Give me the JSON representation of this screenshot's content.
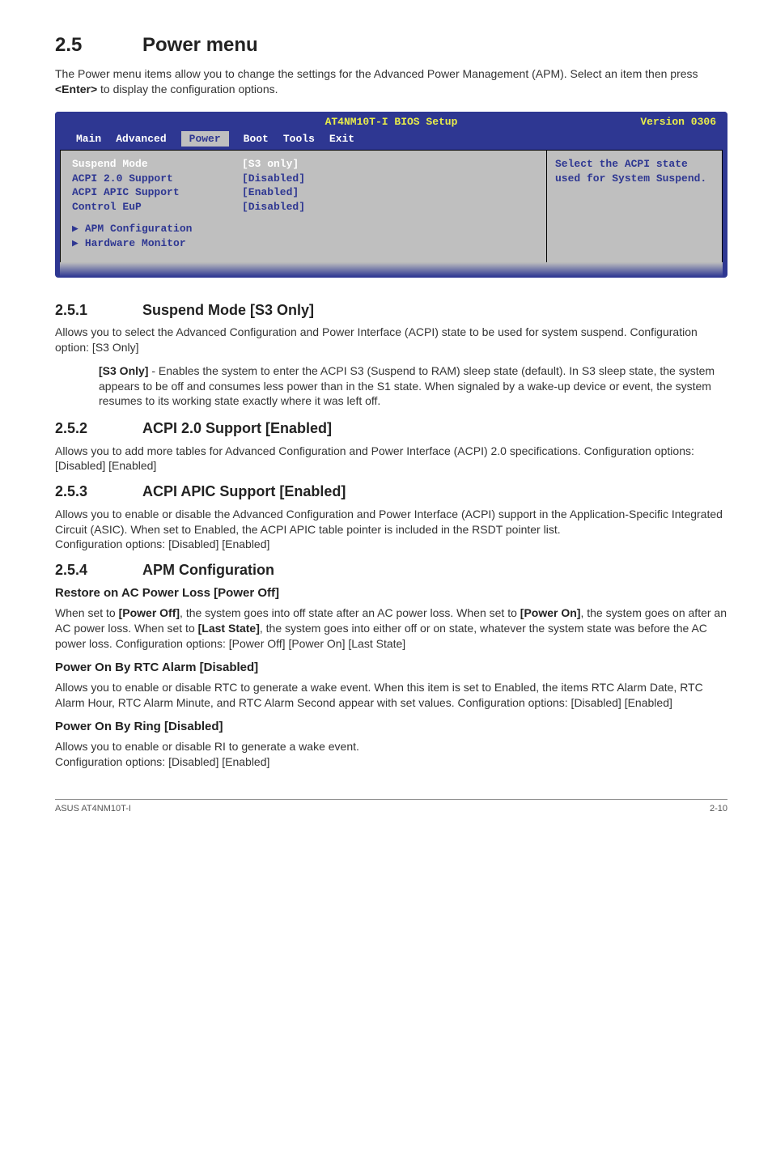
{
  "header": {
    "section_num": "2.5",
    "section_title": "Power menu",
    "intro_a": "The Power menu items allow you to change the settings for the Advanced Power Management (APM). Select an item then press ",
    "intro_key": "<Enter>",
    "intro_b": " to display the configuration options."
  },
  "bios": {
    "title": "AT4NM10T-I BIOS Setup",
    "version": "Version 0306",
    "tabs": {
      "main": "Main",
      "advanced": "Advanced",
      "power": "Power",
      "boot": "Boot",
      "tools": "Tools",
      "exit": "Exit"
    },
    "rows": [
      {
        "label": "Suspend Mode",
        "value": "[S3 only]",
        "selected": true
      },
      {
        "label": "ACPI 2.0 Support",
        "value": "[Disabled]",
        "selected": false
      },
      {
        "label": "ACPI APIC Support",
        "value": "[Enabled]",
        "selected": false
      },
      {
        "label": "Control EuP",
        "value": "[Disabled]",
        "selected": false
      }
    ],
    "submenus": [
      "APM Configuration",
      "Hardware Monitor"
    ],
    "help": "Select the ACPI state used for System Suspend."
  },
  "s251": {
    "num": "2.5.1",
    "title": "Suspend Mode [S3 Only]",
    "p": "Allows you to select the Advanced Configuration and Power Interface (ACPI) state to be used for system suspend. Configuration option: [S3 Only]",
    "indent_label": "[S3 Only]",
    "indent_text": " - Enables the system to enter the ACPI S3 (Suspend to RAM) sleep state (default). In S3 sleep state, the system appears to be off and consumes less power than in the S1 state. When signaled by a wake-up device or event, the system resumes to its working state exactly where it was left off."
  },
  "s252": {
    "num": "2.5.2",
    "title": "ACPI 2.0 Support [Enabled]",
    "p": "Allows you to add more tables for Advanced Configuration and Power Interface (ACPI) 2.0 specifications. Configuration options: [Disabled] [Enabled]"
  },
  "s253": {
    "num": "2.5.3",
    "title": "ACPI APIC Support [Enabled]",
    "p": "Allows you to enable or disable the Advanced Configuration and Power Interface (ACPI) support in the Application-Specific Integrated Circuit (ASIC). When set to Enabled, the ACPI APIC table pointer is included in the RSDT pointer list.",
    "p2": "Configuration options: [Disabled] [Enabled]"
  },
  "s254": {
    "num": "2.5.4",
    "title": "APM Configuration",
    "sub1_title": "Restore on AC Power Loss [Power Off]",
    "sub1_a": "When set to ",
    "sub1_b1": "[Power Off]",
    "sub1_c": ", the system goes into off state after an AC power loss. When set to ",
    "sub1_b2": "[Power On]",
    "sub1_d": ", the system goes on after an AC power loss. When set to ",
    "sub1_b3": "[Last State]",
    "sub1_e": ", the system goes into either off or on state, whatever the system state was before the AC power loss. Configuration options: [Power Off] [Power On] [Last State]",
    "sub2_title": "Power On By RTC Alarm [Disabled]",
    "sub2_p": "Allows you to enable or disable RTC to generate a wake event. When this item is set to Enabled, the items RTC Alarm Date, RTC Alarm Hour, RTC Alarm Minute, and RTC Alarm Second appear with set values. Configuration options: [Disabled] [Enabled]",
    "sub3_title": "Power On By  Ring [Disabled]",
    "sub3_p1": "Allows you to enable or disable RI to generate a wake event.",
    "sub3_p2": "Configuration options: [Disabled] [Enabled]"
  },
  "footer": {
    "left": "ASUS AT4NM10T-I",
    "right": "2-10"
  }
}
